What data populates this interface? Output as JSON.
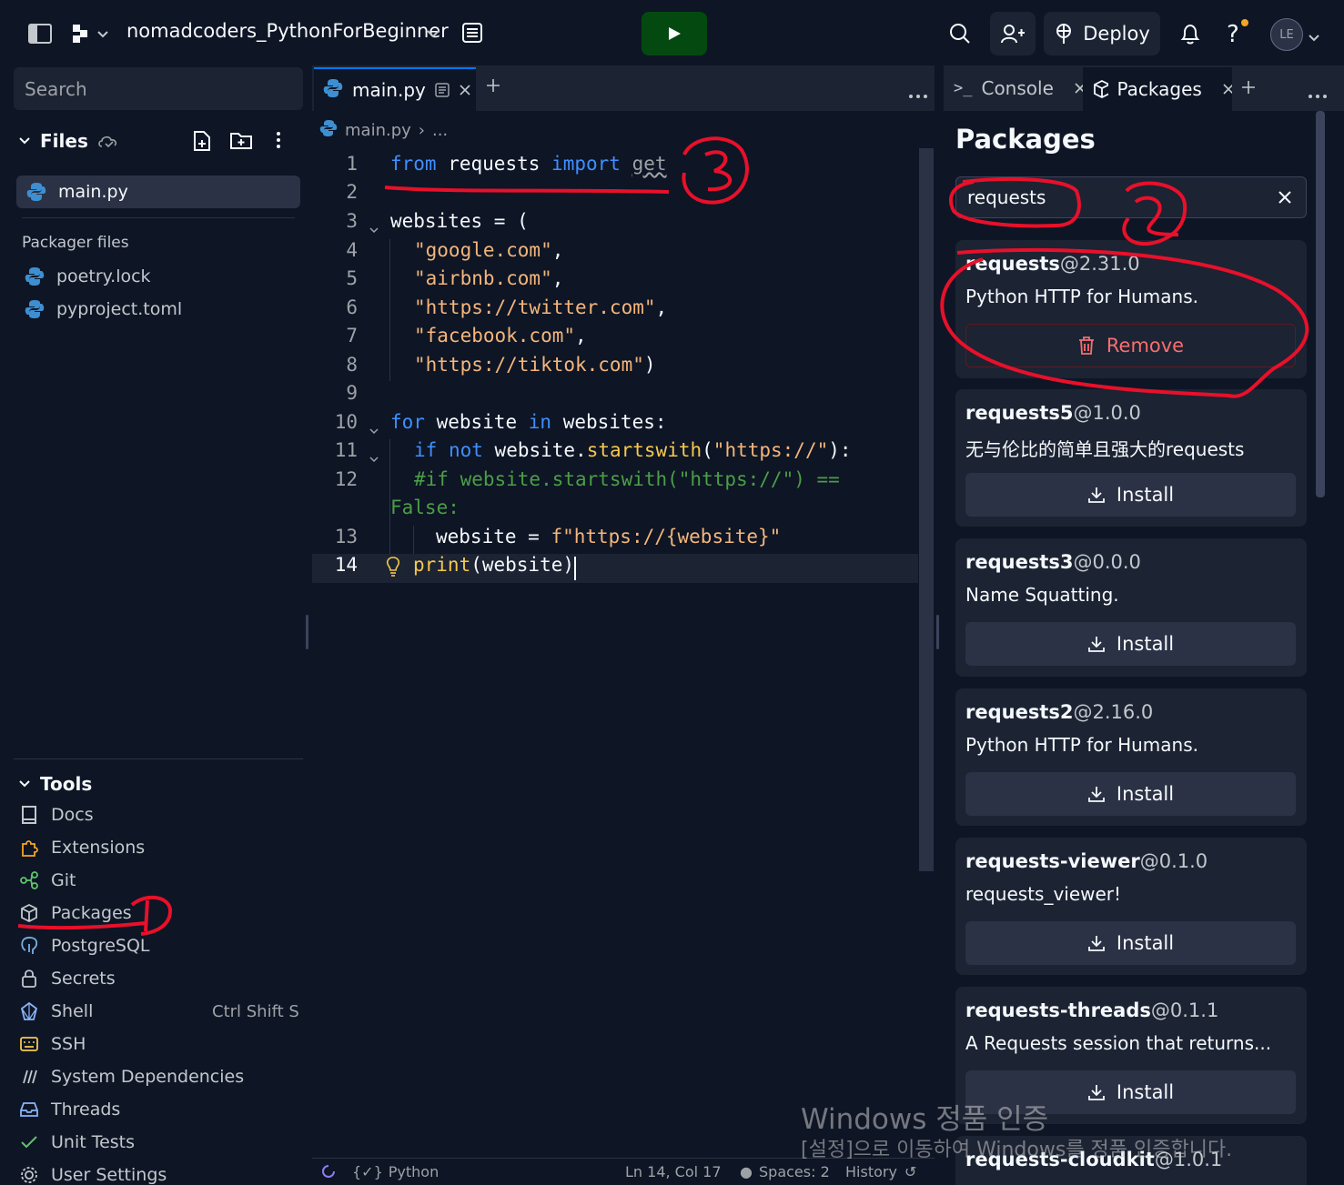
{
  "topbar": {
    "project_name": "nomadcoders_PythonForBeginner",
    "deploy_label": "Deploy",
    "avatar_initials": "LE",
    "icons": [
      "sidebar-toggle-icon",
      "workspace-icon",
      "chevron-down-icon",
      "menu-list-icon",
      "play-icon",
      "search-icon",
      "invite-user-icon",
      "deploy-icon",
      "bell-icon",
      "help-icon"
    ]
  },
  "sidebar": {
    "search_placeholder": "Search",
    "files_header": "Files",
    "files": [
      {
        "name": "main.py"
      }
    ],
    "packager_header": "Packager files",
    "packager_files": [
      {
        "name": "poetry.lock"
      },
      {
        "name": "pyproject.toml"
      }
    ],
    "tools_header": "Tools",
    "tools": [
      {
        "label": "Docs",
        "icon": "book-icon"
      },
      {
        "label": "Extensions",
        "icon": "puzzle-icon"
      },
      {
        "label": "Git",
        "icon": "git-icon"
      },
      {
        "label": "Packages",
        "icon": "package-icon"
      },
      {
        "label": "PostgreSQL",
        "icon": "postgres-icon"
      },
      {
        "label": "Secrets",
        "icon": "lock-icon"
      },
      {
        "label": "Shell",
        "icon": "shell-icon",
        "shortcut": "Ctrl Shift S"
      },
      {
        "label": "SSH",
        "icon": "keyboard-icon"
      },
      {
        "label": "System Dependencies",
        "icon": "dependencies-icon"
      },
      {
        "label": "Threads",
        "icon": "inbox-icon"
      },
      {
        "label": "Unit Tests",
        "icon": "check-icon"
      },
      {
        "label": "User Settings",
        "icon": "gear-icon"
      }
    ]
  },
  "editor": {
    "tab_label": "main.py",
    "breadcrumb_file": "main.py",
    "breadcrumb_more": "...",
    "lines": [
      {
        "n": "1"
      },
      {
        "n": "2"
      },
      {
        "n": "3"
      },
      {
        "n": "4"
      },
      {
        "n": "5"
      },
      {
        "n": "6"
      },
      {
        "n": "7"
      },
      {
        "n": "8"
      },
      {
        "n": "9"
      },
      {
        "n": "10"
      },
      {
        "n": "11"
      },
      {
        "n": "12"
      },
      {
        "n": "13"
      },
      {
        "n": "14"
      }
    ],
    "code": {
      "l1_from": "from",
      "l1_mod": "requests",
      "l1_import": "import",
      "l1_get": "get",
      "l3": "websites = (",
      "l4": "\"google.com\"",
      "l5": "\"airbnb.com\"",
      "l6": "\"https://twitter.com\"",
      "l7": "\"facebook.com\"",
      "l8": "\"https://tiktok.com\"",
      "l10_for": "for",
      "l10_var": "website",
      "l10_in": "in",
      "l10_rest": "websites:",
      "l11_if": "if",
      "l11_not": "not",
      "l11_obj": "website.",
      "l11_fn": "startswith",
      "l11_str": "\"https://\"",
      "l12_comment_a": "#if website.startswith(\"https://\") ==",
      "l12_comment_b": "False:",
      "l13_var": "website = ",
      "l13_str": "f\"https://{website}\"",
      "l14_fn": "print",
      "l14_arg": "(website)"
    },
    "status": {
      "language": "Python",
      "position": "Ln 14, Col 17",
      "spaces": "Spaces: 2",
      "history": "History"
    }
  },
  "right_panel": {
    "tabs": [
      {
        "label": "Console"
      },
      {
        "label": "Packages"
      }
    ],
    "title": "Packages",
    "search_value": "requests",
    "packages": [
      {
        "name": "requests",
        "version": "@2.31.0",
        "desc": "Python HTTP for Humans.",
        "action": "Remove"
      },
      {
        "name": "requests5",
        "version": "@1.0.0",
        "desc": "无与伦比的简单且强大的requests",
        "action": "Install"
      },
      {
        "name": "requests3",
        "version": "@0.0.0",
        "desc": "Name Squatting.",
        "action": "Install"
      },
      {
        "name": "requests2",
        "version": "@2.16.0",
        "desc": "Python HTTP for Humans.",
        "action": "Install"
      },
      {
        "name": "requests-viewer",
        "version": "@0.1.0",
        "desc": "requests_viewer!",
        "action": "Install"
      },
      {
        "name": "requests-threads",
        "version": "@0.1.1",
        "desc": "A Requests session that returns...",
        "action": "Install"
      },
      {
        "name": "requests-cloudkit",
        "version": "@1.0.1",
        "desc": "",
        "action": ""
      }
    ]
  },
  "watermark": {
    "line1": "Windows 정품 인증",
    "line2": "[설정]으로 이동하여 Windows를 정품 인증합니다."
  },
  "colors": {
    "accent": "#0079f2",
    "run_green": "#044a10",
    "remove_red": "#f76e6e",
    "annotation_red": "#e8102a"
  }
}
